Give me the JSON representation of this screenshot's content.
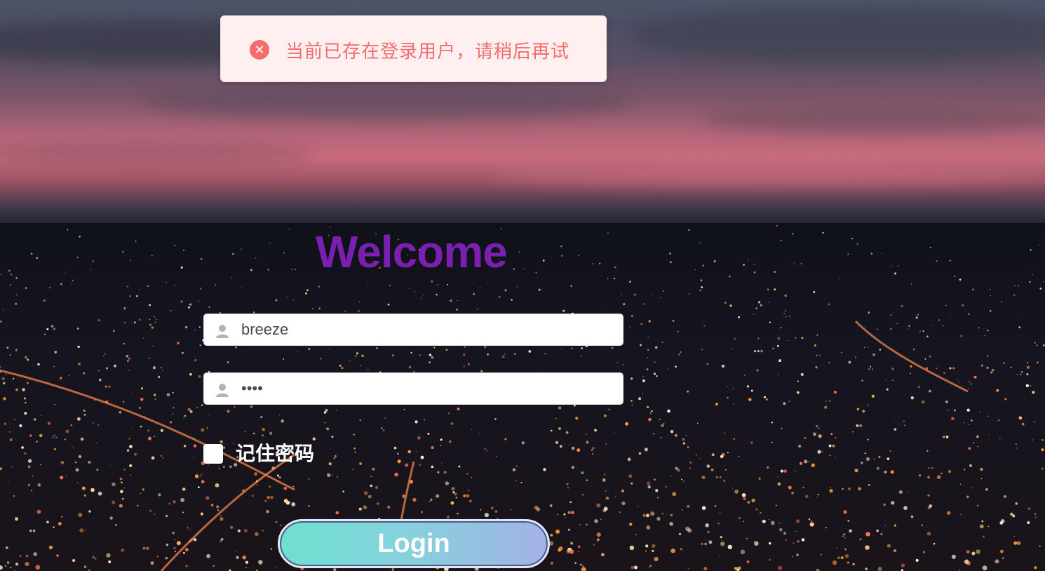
{
  "toast": {
    "icon": "error-circle-icon",
    "message": "当前已存在登录用户，请稍后再试",
    "color": "#f56c6c",
    "background": "#fef0f0"
  },
  "welcome": {
    "title": "Welcome",
    "color": "#7a1fb0"
  },
  "form": {
    "username": {
      "icon": "user-icon",
      "value": "breeze"
    },
    "password": {
      "icon": "user-icon",
      "value": "••••"
    },
    "remember": {
      "label": "记住密码",
      "checked": false
    },
    "login_button": {
      "label": "Login"
    }
  }
}
